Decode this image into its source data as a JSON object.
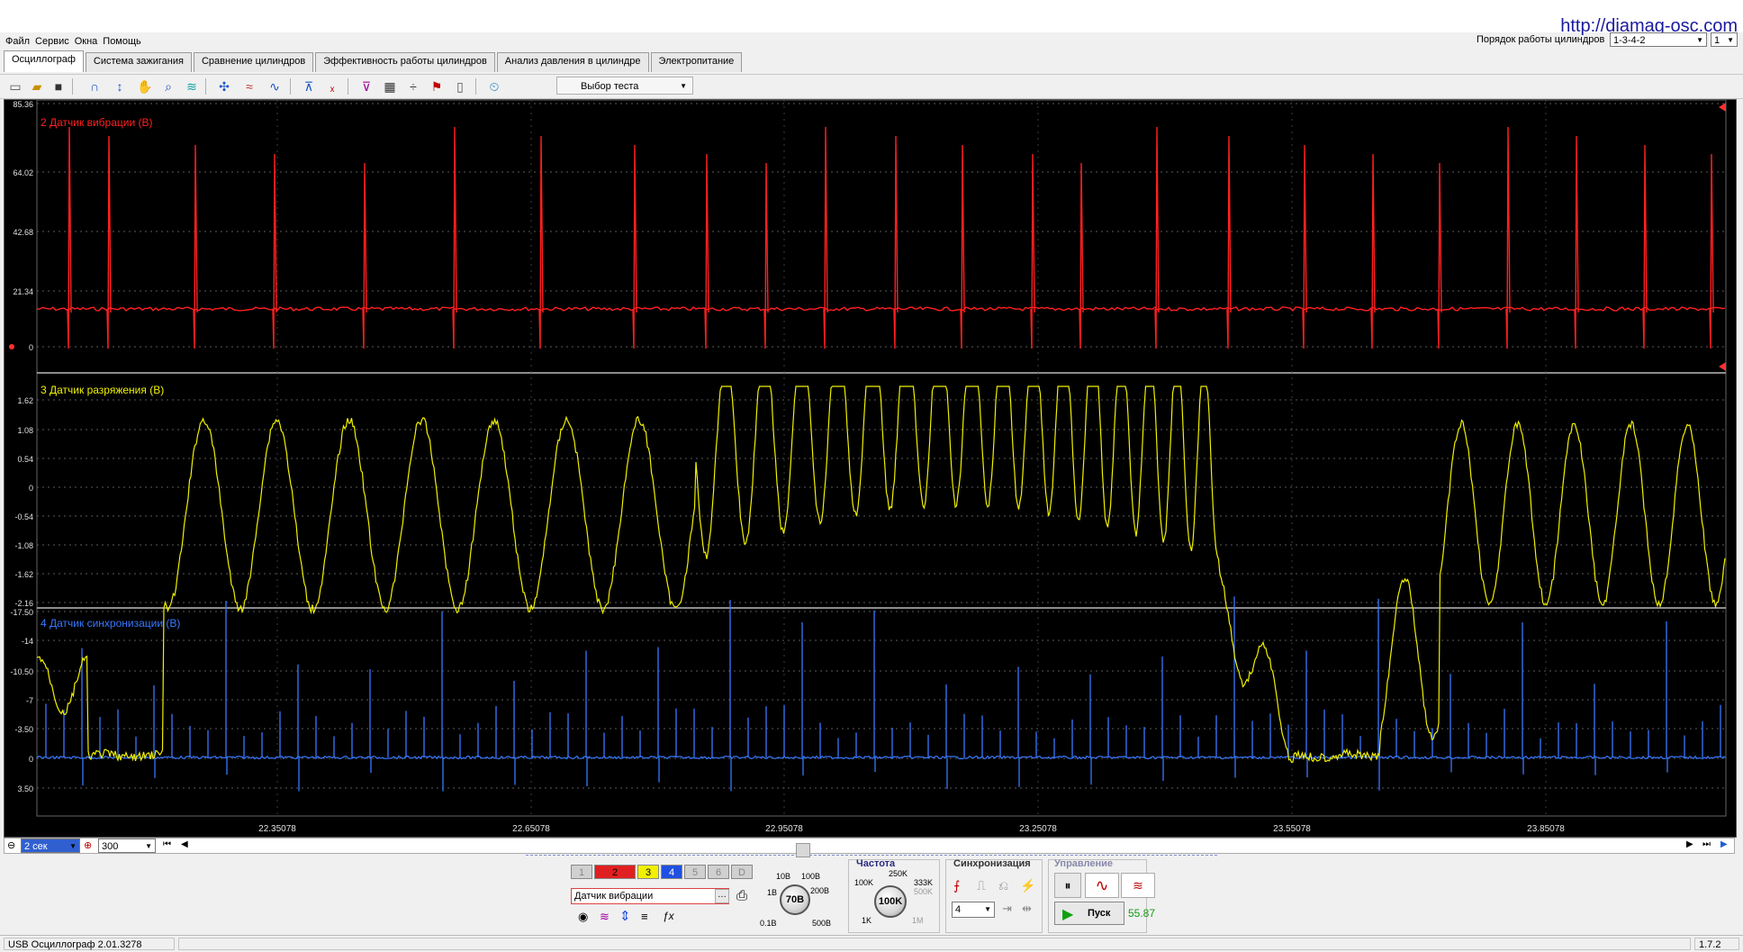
{
  "menu": [
    "Файл",
    "Сервис",
    "Окна",
    "Помощь"
  ],
  "site_link": "http://diamag-osc.com",
  "cylinder_order": {
    "label": "Порядок работы цилиндров",
    "value": "1-3-4-2",
    "second_value": "1"
  },
  "tabs": [
    "Осциллограф",
    "Система зажигания",
    "Сравнение цилиндров",
    "Эффективность работы цилиндров",
    "Анализ давления в цилиндре",
    "Электропитание"
  ],
  "active_tab": "Осциллограф",
  "toolbar": {
    "test_select": "Выбор теста"
  },
  "channels": [
    {
      "title": "2 Датчик вибрации (В)",
      "color": "#ff2020",
      "ticks": [
        "85.36",
        "64.02",
        "42.68",
        "21.34",
        "0"
      ]
    },
    {
      "title": "3 Датчик разряжения (В)",
      "color": "#f0f000",
      "ticks": [
        "1.62",
        "1.08",
        "0.54",
        "0",
        "-0.54",
        "-1.08",
        "-1.62",
        "-2.16"
      ]
    },
    {
      "title": "4 Датчик синхронизации (В)",
      "color": "#3878ff",
      "ticks": [
        "-17.50",
        "-14",
        "-10.50",
        "-7",
        "-3.50",
        "0",
        "3.50"
      ]
    }
  ],
  "time_axis": {
    "ticks": [
      "22.35078",
      "22.65078",
      "22.95078",
      "23.25078",
      "23.55078",
      "23.85078"
    ]
  },
  "timebar": {
    "time_per_div": "2 сек",
    "zoom": "300"
  },
  "controls": {
    "channel_buttons": [
      "1",
      "2",
      "3",
      "4",
      "5",
      "6",
      "D"
    ],
    "channel_name": "Датчик вибрации",
    "volts_group": {
      "value": "70В",
      "labels": [
        "10В",
        "100В",
        "1В",
        "200В",
        "0.1В",
        "500В"
      ]
    },
    "freq_group": {
      "title": "Частота",
      "value": "100K",
      "labels": [
        "250K",
        "100K",
        "333K",
        "500K",
        "1K",
        "1M"
      ]
    },
    "sync_group": {
      "title": "Синхронизация",
      "channel": "4"
    },
    "control_group": {
      "title": "Управление",
      "start": "Пуск",
      "readout": "55.87"
    }
  },
  "statusbar": {
    "app": "USB Осциллограф  2.01.3278",
    "version": "1.7.2"
  }
}
